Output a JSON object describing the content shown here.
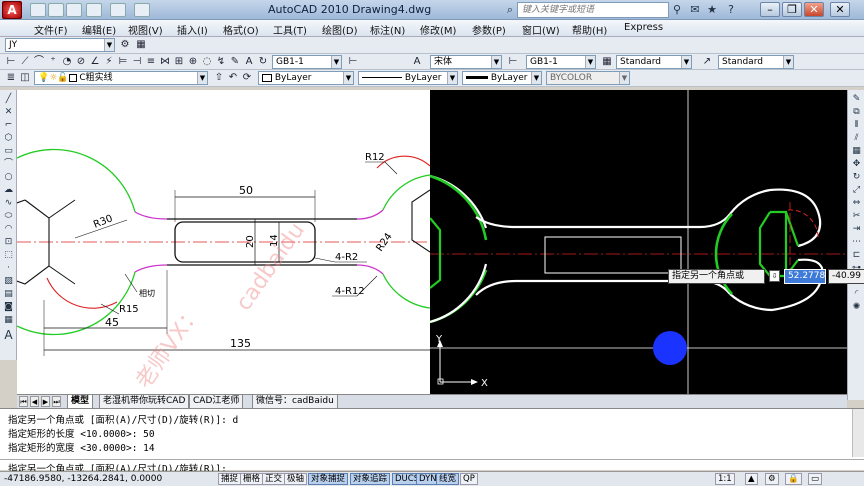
{
  "app": {
    "title": "AutoCAD 2010",
    "file": "Drawing4.dwg",
    "search_placeholder": "键入关键字或短语"
  },
  "menu": [
    "文件(F)",
    "编辑(E)",
    "视图(V)",
    "插入(I)",
    "格式(O)",
    "工具(T)",
    "绘图(D)",
    "标注(N)",
    "修改(M)",
    "参数(P)",
    "窗口(W)",
    "帮助(H)",
    "Express"
  ],
  "toolbar1": {
    "workspace": "JY"
  },
  "toolbar2": {
    "dimstyle": "GB1-1",
    "textstyle": "宋体",
    "dimstyle2": "GB1-1",
    "tablestyle": "Standard",
    "mleaderstyle": "Standard"
  },
  "toolbar3": {
    "layer": "C粗实线",
    "color": "ByLayer",
    "linetype": "ByLayer",
    "lineweight": "ByLayer",
    "plotstyle": "BYCOLOR"
  },
  "drawing": {
    "dims": {
      "d50": "50",
      "d20": "20",
      "d14": "14",
      "r12": "R12",
      "r30": "R30",
      "r24": "R24",
      "r15": "R15",
      "r2": "4-R2",
      "r12b": "4-R12",
      "d45": "45",
      "d135": "135",
      "note": "相切"
    },
    "watermark1": "cadbaidu",
    "watermark2": "老师VX：",
    "ucs_x": "X",
    "ucs_y": "Y"
  },
  "dynamic_input": {
    "prompt": "指定另一个角点或",
    "x": "52.2778",
    "y": "-40.99"
  },
  "tabs": [
    "模型",
    "老湿机带你玩转CAD",
    "CAD江老师",
    "微信号：cadBaidu"
  ],
  "command": {
    "lines": [
      "指定另一个角点或 [面积(A)/尺寸(D)/旋转(R)]: d",
      "指定矩形的长度 <10.0000>: 50",
      "指定矩形的宽度 <30.0000>: 14"
    ],
    "prompt": "指定另一个角点或 [面积(A)/尺寸(D)/旋转(R)]:"
  },
  "status": {
    "coords": "-47186.9580, -13264.2841, 0.0000",
    "buttons": [
      "捕捉",
      "栅格",
      "正交",
      "极轴",
      "对象捕捉",
      "对象追踪",
      "DUCS",
      "DYN",
      "线宽",
      "QP"
    ],
    "on": [
      "对象捕捉",
      "对象追踪",
      "DUCS",
      "DYN",
      "线宽"
    ],
    "scale": "1:1"
  },
  "colors": {
    "green": "#22cc22",
    "red": "#dd2222",
    "magenta": "#cc33cc",
    "blue_dot": "#1a33ff"
  }
}
